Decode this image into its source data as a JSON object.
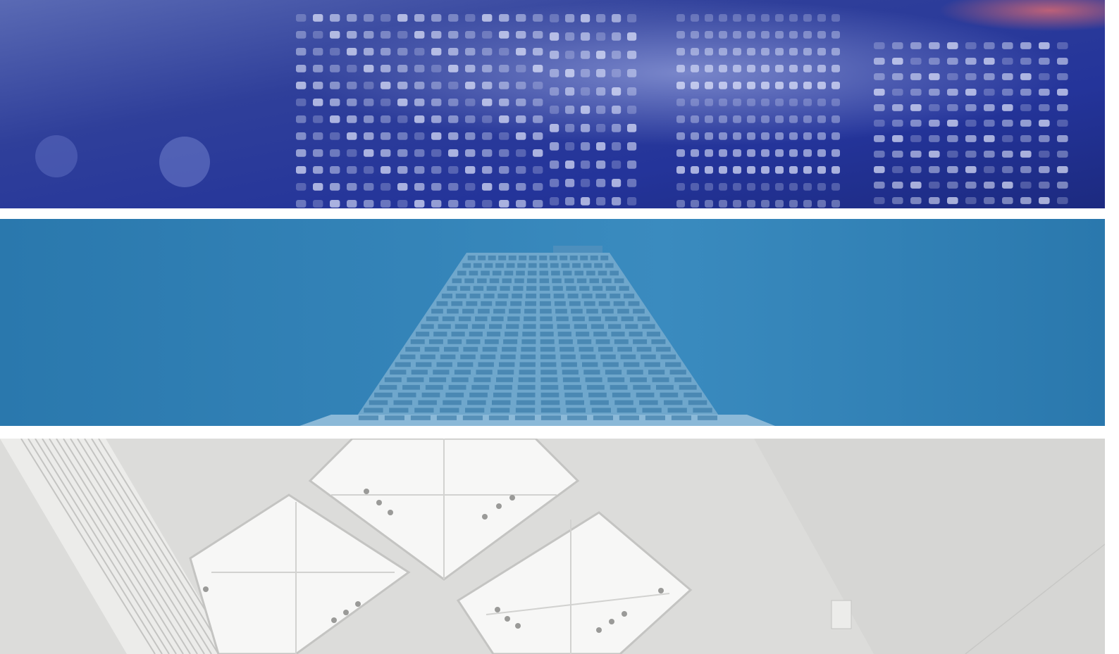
{
  "banners": [
    {
      "subject": "led-ticker-display",
      "colors": {
        "base": "#2f3f9a",
        "deep": "#1c2a80",
        "light": "#8f9ee0",
        "dot": "#e6ebff",
        "accent": "#e06a70"
      }
    },
    {
      "subject": "skyscraper-from-below",
      "colors": {
        "sky": "#2a78ad",
        "sky_light": "#3a8bbf",
        "building": "#6fa7cc",
        "grid": "#9cc4de",
        "window": "#2c6f9f"
      }
    },
    {
      "subject": "skylight-ceiling",
      "colors": {
        "base": "#d6d6d4",
        "light": "#ececea",
        "glass": "#f7f7f6",
        "frame": "#c4c4c2",
        "shadow": "#b9b9b7"
      }
    }
  ]
}
